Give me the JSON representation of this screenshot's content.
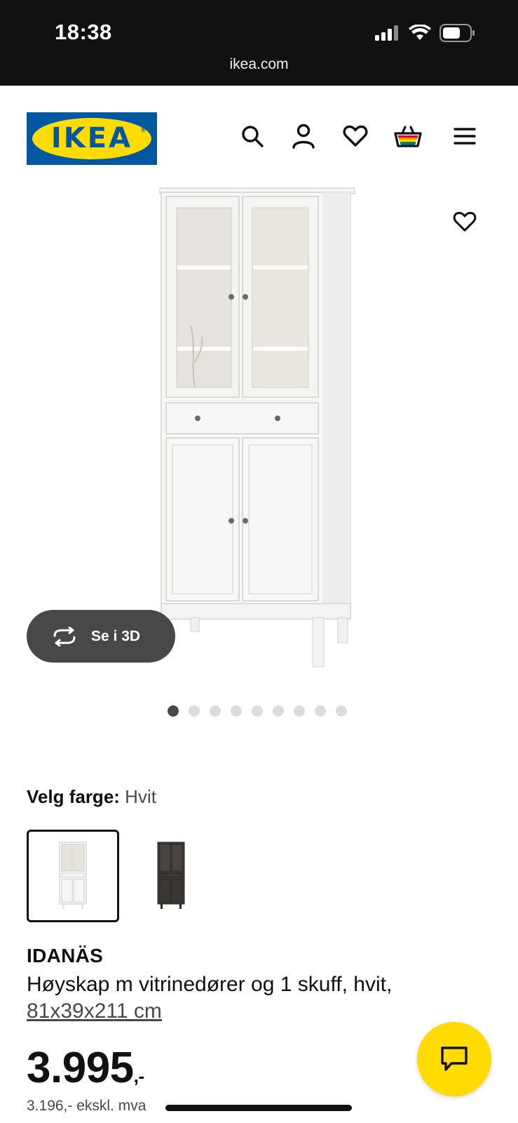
{
  "status_bar": {
    "time": "18:38",
    "icons": [
      "signal-icon",
      "wifi-icon",
      "battery-icon"
    ]
  },
  "browser": {
    "url": "ikea.com"
  },
  "header": {
    "logo_text": "IKEA",
    "logo_reg": "®",
    "brand_colors": {
      "blue": "#0058a3",
      "yellow": "#ffdb00"
    },
    "icons": [
      "search-icon",
      "account-icon",
      "wishlist-icon",
      "cart-icon",
      "menu-icon"
    ]
  },
  "gallery": {
    "view_3d_label": "Se i 3D",
    "image_count": 9,
    "active_index": 0
  },
  "color_selector": {
    "label": "Velg farge:",
    "selected_value": "Hvit",
    "options": [
      {
        "name": "white-cabinet",
        "color": "#f4f4f2",
        "selected": true
      },
      {
        "name": "dark-cabinet",
        "color": "#3a3735",
        "selected": false
      }
    ]
  },
  "product": {
    "name": "IDANÄS",
    "description": "Høyskap m vitrinedører og 1 skuff, hvit,",
    "dimensions": "81x39x211 cm",
    "price": "3.995",
    "price_suffix": ",-",
    "price_ex_vat": "3.196,- ekskl. mva"
  },
  "chat": {
    "color": "#ffdb00"
  }
}
